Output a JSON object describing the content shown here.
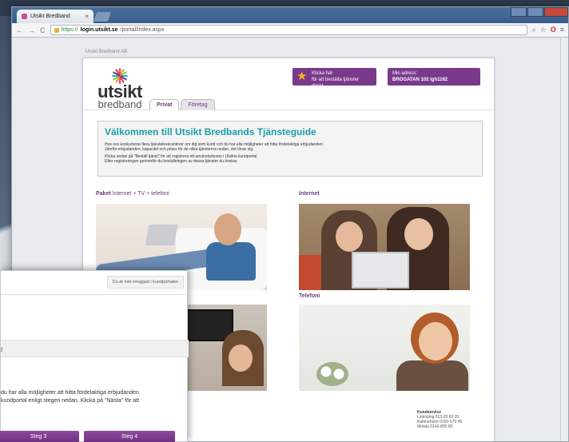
{
  "browser": {
    "tab_title": "Utsikt Bredband",
    "tab_close": "×",
    "nav_back": "←",
    "nav_forward": "→",
    "nav_reload": "C",
    "url_scheme": "https://",
    "url_host": "login.utsikt.se",
    "url_path": "/portal/index.aspx",
    "icon_zoom": "⌕",
    "icon_star": "☆",
    "icon_opera": "O",
    "icon_menu": "≡"
  },
  "page": {
    "company_small": "Utsikt Bredband AB",
    "logo_word1": "utsikt",
    "logo_word2": "bredband",
    "promo_order_line1": "Klicka här",
    "promo_order_line2": "för att beställa tjänster direkt",
    "promo_addr_line1": "Min adress:",
    "promo_addr_line2": "BROGATAN 102 lgh1162",
    "tabs": [
      {
        "label": "Privat"
      },
      {
        "label": "Företag"
      }
    ],
    "welcome_title": "Välkommen till Utsikt Bredbands Tjänsteguide",
    "welcome_p1a": "Hos oss konkurrerar flera tjänsteleverantörer om dig som kund och du har alla möjligheter att hitta fördelaktiga erbjudanden.",
    "welcome_p1b": "Jämför erbjudanden, kapacitet och priser för de olika tjänsterna nedan, det lönar sig.",
    "welcome_p2a": "Klicka sedan på \"Beställ tjänst\" för att registrera ett användarkonto i Utsikts kundportal.",
    "welcome_p2b": "Efter registreringen genomför du beställningen av dessa tjänster du önskar.",
    "sec_paket_bold": "Paket",
    "sec_paket_rest": " Internet + TV + telefoni",
    "sec_internet": "Internet",
    "sec_telefoni": "Telefoni",
    "footer_title": "Kundservice",
    "footer_l1": "Linköping 013-20 83 20",
    "footer_l2": "Katrineholm 0150-579 45",
    "footer_l3": "Motala 0142-855 85"
  },
  "overlay": {
    "status": "Du är inte inloggad i kundportalen",
    "band_label": "r",
    "text_l1": "du har alla möjligheter att hitta fördelaktiga erbjudanden.",
    "text_l2": "kundportal enligt stegen nedan. Klicka på \"Nästa\" för att",
    "step3": "Steg 3",
    "step4": "Steg 4"
  },
  "colors": {
    "brand_purple": "#7a3a8c",
    "heading_teal": "#1c9fa8"
  }
}
